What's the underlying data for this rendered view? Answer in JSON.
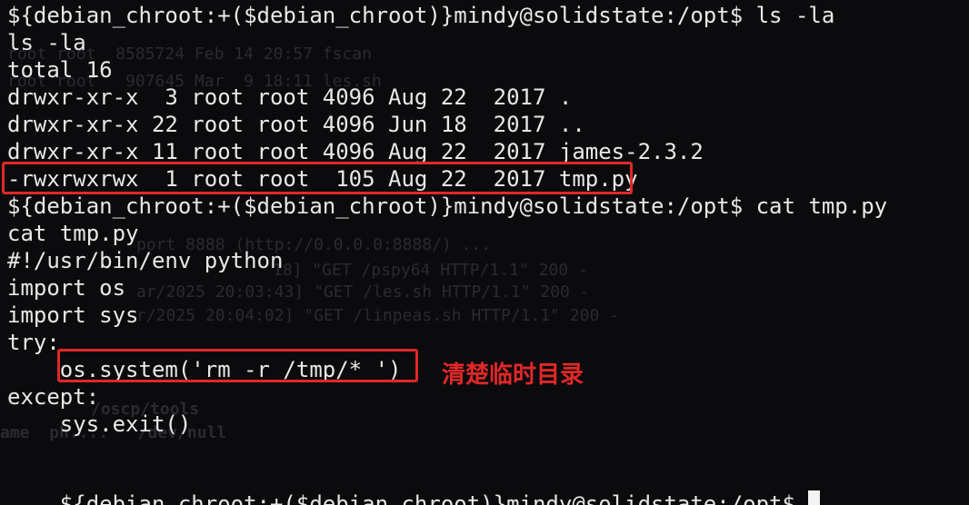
{
  "terminal": {
    "lines": [
      "${debian_chroot:+($debian_chroot)}mindy@solidstate:/opt$ ls -la",
      "ls -la",
      "total 16",
      "drwxr-xr-x  3 root root 4096 Aug 22  2017 .",
      "drwxr-xr-x 22 root root 4096 Jun 18  2017 ..",
      "drwxr-xr-x 11 root root 4096 Aug 22  2017 james-2.3.2",
      "-rwxrwxrwx  1 root root  105 Aug 22  2017 tmp.py",
      "${debian_chroot:+($debian_chroot)}mindy@solidstate:/opt$ cat tmp.py",
      "cat tmp.py",
      "#!/usr/bin/env python",
      "import os",
      "import sys",
      "try:",
      "    os.system('rm -r /tmp/* ')",
      "except:",
      "    sys.exit()",
      "",
      "${debian_chroot:+($debian_chroot)}mindy@solidstate:/opt$ "
    ]
  },
  "annotation": {
    "text": "清楚临时目录",
    "color": "#e02828"
  },
  "ghost_text": {
    "l1": "root root  8585724 Feb 14 20:57 fscan",
    "l2": "root root   907645 Mar  9 18:11 les.sh",
    "l3": "port 8888 (http://0.0.0.0:8888/) ...",
    "l4": "18] \"GET /pspy64 HTTP/1.1\" 200 -",
    "l5": "ar/2025 20:03:43] \"GET /les.sh HTTP/1.1\" 200 -",
    "l6": "r/2025 20:04:02] \"GET /linpeas.sh HTTP/1.1\" 200 -",
    "l7": "/oscp/tools",
    "l8": "ame  ph....   /dev/null"
  }
}
